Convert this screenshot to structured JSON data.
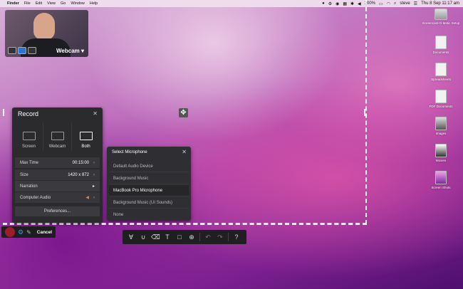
{
  "menubar": {
    "app": "Finder",
    "menus": [
      "File",
      "Edit",
      "View",
      "Go",
      "Window",
      "Help"
    ],
    "battery": "100%",
    "user": "steve",
    "datetime": "Thu 8 Sep  11:17 am"
  },
  "desktop": {
    "items": [
      {
        "label": "Screencast-O-Matic Setup",
        "icon": "drive-icon"
      },
      {
        "label": "Documents",
        "icon": "folder-icon"
      },
      {
        "label": "Spreadsheets",
        "icon": "document-icon"
      },
      {
        "label": "PDF Documents",
        "icon": "pdf-icon"
      },
      {
        "label": "Images",
        "icon": "image-icon"
      },
      {
        "label": "Movies",
        "icon": "movie-icon"
      },
      {
        "label": "Screen Shots",
        "icon": "screenshot-icon"
      }
    ]
  },
  "webcam": {
    "label": "Webcam ▾"
  },
  "record": {
    "title": "Record",
    "modes": [
      {
        "label": "Screen"
      },
      {
        "label": "Webcam"
      },
      {
        "label": "Both"
      }
    ],
    "max_time_label": "Max Time",
    "max_time_value": "00:15:00",
    "size_label": "Size",
    "size_value": "1420 x 872",
    "narration_label": "Narration",
    "computer_audio_label": "Computer Audio",
    "preferences_label": "Preferences..."
  },
  "microphone": {
    "title": "Select Microphone",
    "options": [
      "Default Audio Device",
      "Background Music",
      "MacBook Pro Microphone",
      "Background Music (UI Sounds)",
      "None"
    ],
    "selected": "MacBook Pro Microphone"
  },
  "controls": {
    "cancel_label": "Cancel"
  }
}
